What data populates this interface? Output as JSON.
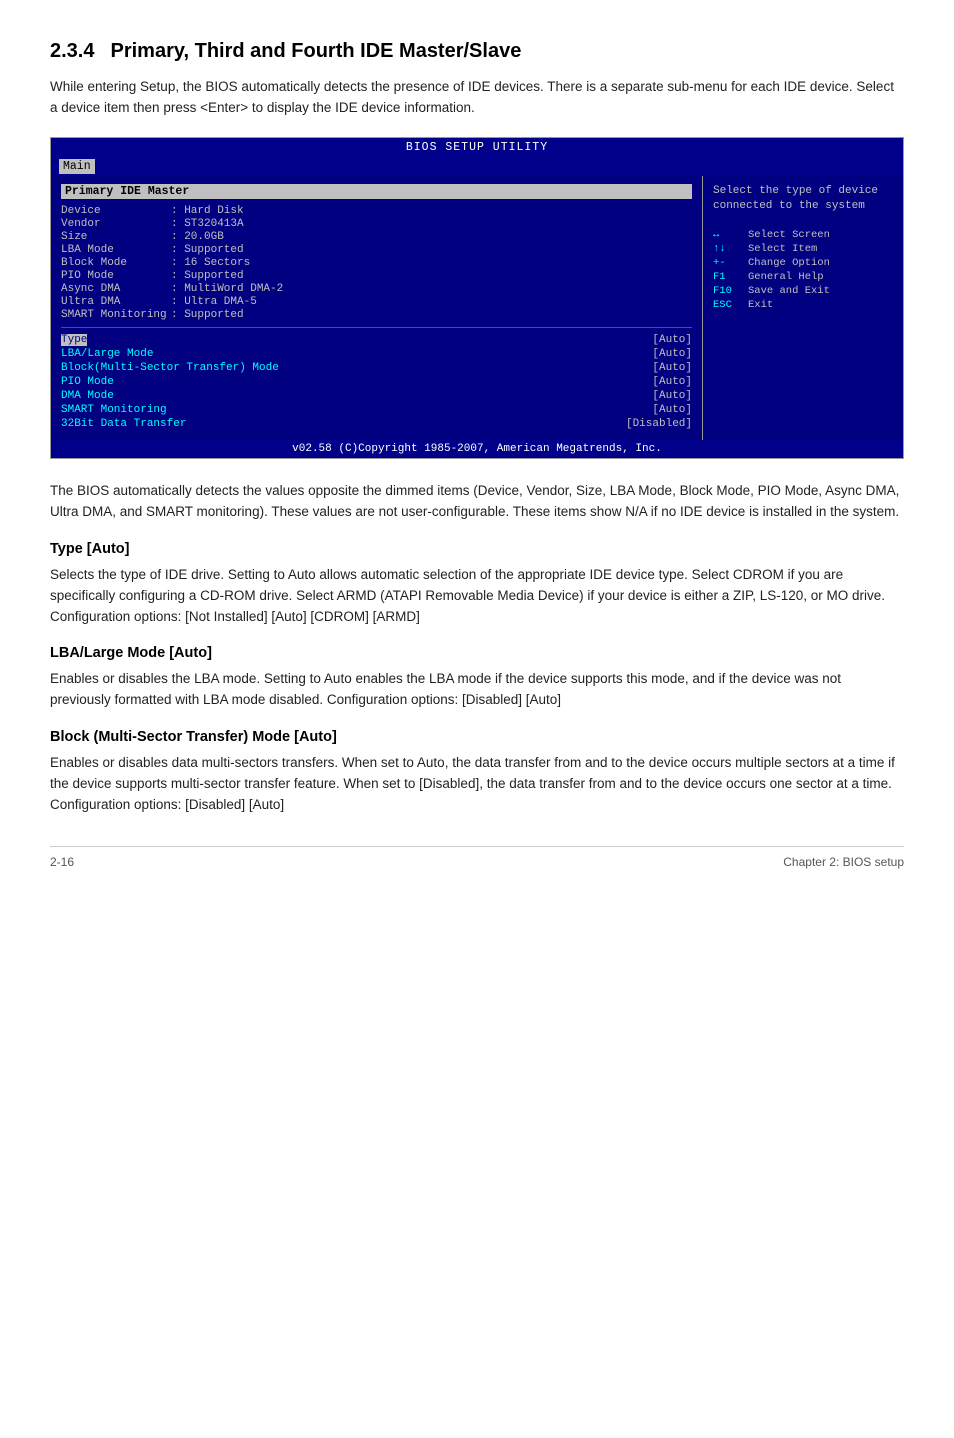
{
  "section": {
    "number": "2.3.4",
    "title": "Primary, Third and Fourth IDE Master/Slave"
  },
  "intro": "While entering Setup, the BIOS automatically detects the presence of IDE devices. There is a separate sub-menu for each IDE device. Select a device item then press <Enter> to display the IDE device information.",
  "bios": {
    "title": "BIOS  SETUP  UTILITY",
    "nav_active": "Main",
    "section_header": "Primary IDE Master",
    "info_rows": [
      {
        "label": "Device",
        "value": ": Hard Disk"
      },
      {
        "label": "Vendor",
        "value": ": ST320413A"
      },
      {
        "label": "Size",
        "value": ": 20.0GB"
      },
      {
        "label": "LBA Mode",
        "value": ": Supported"
      },
      {
        "label": "Block Mode",
        "value": ": 16 Sectors"
      },
      {
        "label": "PIO Mode",
        "value": ": Supported"
      },
      {
        "label": "Async DMA",
        "value": ": MultiWord DMA-2"
      },
      {
        "label": "Ultra DMA",
        "value": ": Ultra DMA-5"
      },
      {
        "label": "SMART Monitoring",
        "value": ": Supported"
      }
    ],
    "options": [
      {
        "label": "Type",
        "value": "[Auto]",
        "highlight": true
      },
      {
        "label": "LBA/Large Mode",
        "value": "[Auto]"
      },
      {
        "label": "Block(Multi-Sector Transfer) Mode",
        "value": "[Auto]"
      },
      {
        "label": "PIO Mode",
        "value": "[Auto]"
      },
      {
        "label": "DMA Mode",
        "value": "[Auto]"
      },
      {
        "label": "SMART Monitoring",
        "value": "[Auto]"
      },
      {
        "label": "32Bit Data Transfer",
        "value": "[Disabled]"
      }
    ],
    "help_text": "Select the type of\ndevice connected\nto the system",
    "keys": [
      {
        "symbol": "↔",
        "desc": "Select Screen"
      },
      {
        "symbol": "↑↓",
        "desc": "Select Item"
      },
      {
        "symbol": "+-",
        "desc": "Change Option"
      },
      {
        "symbol": "F1",
        "desc": "General Help"
      },
      {
        "symbol": "F10",
        "desc": "Save and Exit"
      },
      {
        "symbol": "ESC",
        "desc": "Exit"
      }
    ],
    "footer": "v02.58 (C)Copyright 1985-2007, American Megatrends, Inc."
  },
  "body_paragraph": "The BIOS automatically detects the values opposite the dimmed items (Device, Vendor, Size, LBA Mode, Block Mode, PIO Mode, Async DMA, Ultra DMA, and SMART monitoring). These values are not user-configurable. These items show N/A if no IDE device is installed in the system.",
  "subsections": [
    {
      "title": "Type [Auto]",
      "body": "Selects the type of IDE drive. Setting to Auto allows automatic selection of the appropriate IDE device type. Select CDROM if you are specifically configuring a CD-ROM drive. Select ARMD (ATAPI Removable Media Device) if your device is either a ZIP, LS-120, or MO drive. Configuration options: [Not Installed] [Auto] [CDROM] [ARMD]"
    },
    {
      "title": "LBA/Large Mode [Auto]",
      "body": "Enables or disables the LBA mode. Setting to Auto enables the LBA mode if the device supports this mode, and if the device was not previously formatted with LBA mode disabled. Configuration options: [Disabled] [Auto]"
    },
    {
      "title": "Block (Multi-Sector Transfer) Mode [Auto]",
      "body": "Enables or disables data multi-sectors transfers. When set to Auto, the data transfer from and to the device occurs multiple sectors at a time if the device supports multi-sector transfer feature. When set to [Disabled], the data transfer from and to the device occurs one sector at a time. Configuration options: [Disabled] [Auto]"
    }
  ],
  "footer": {
    "left": "2-16",
    "right": "Chapter 2: BIOS setup"
  }
}
